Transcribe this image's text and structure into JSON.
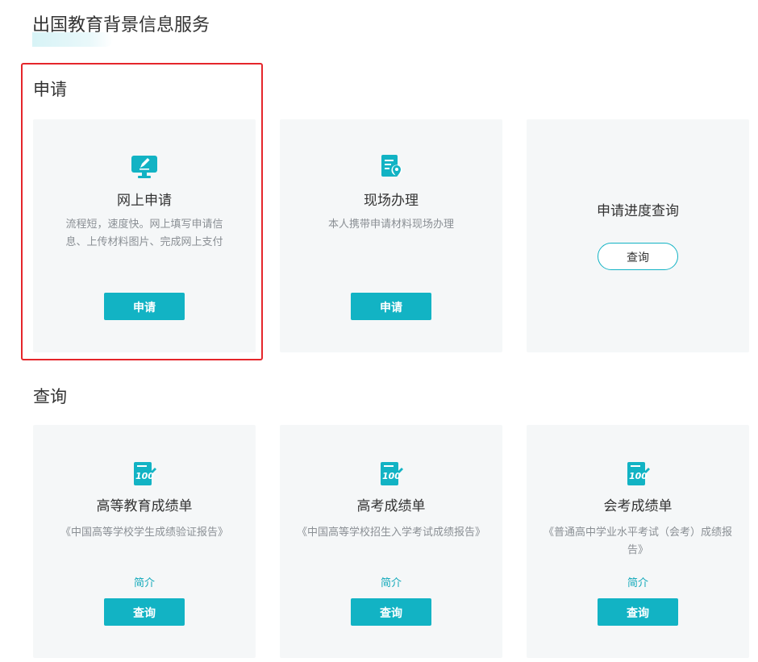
{
  "page": {
    "title": "出国教育背景信息服务"
  },
  "colors": {
    "accent": "#12b3c4",
    "card_bg": "#f5f7f8",
    "highlight": "#e5262b"
  },
  "apply_section": {
    "title": "申请",
    "cards": [
      {
        "icon": "monitor-pen-icon",
        "title": "网上申请",
        "description": "流程短，速度快。网上填写申请信息、上传材料图片、完成网上支付",
        "button": "申请"
      },
      {
        "icon": "document-location-icon",
        "title": "现场办理",
        "description": "本人携带申请材料现场办理",
        "button": "申请"
      },
      {
        "icon": "",
        "title": "申请进度查询",
        "description": "",
        "button": "查询"
      }
    ]
  },
  "query_section": {
    "title": "查询",
    "cards": [
      {
        "icon": "score-100-icon",
        "title": "高等教育成绩单",
        "description": "《中国高等学校学生成绩验证报告》",
        "link": "简介",
        "button": "查询"
      },
      {
        "icon": "score-100-icon",
        "title": "高考成绩单",
        "description": "《中国高等学校招生入学考试成绩报告》",
        "link": "简介",
        "button": "查询"
      },
      {
        "icon": "score-100-icon",
        "title": "会考成绩单",
        "description": "《普通高中学业水平考试（会考）成绩报告》",
        "link": "简介",
        "button": "查询"
      }
    ]
  }
}
